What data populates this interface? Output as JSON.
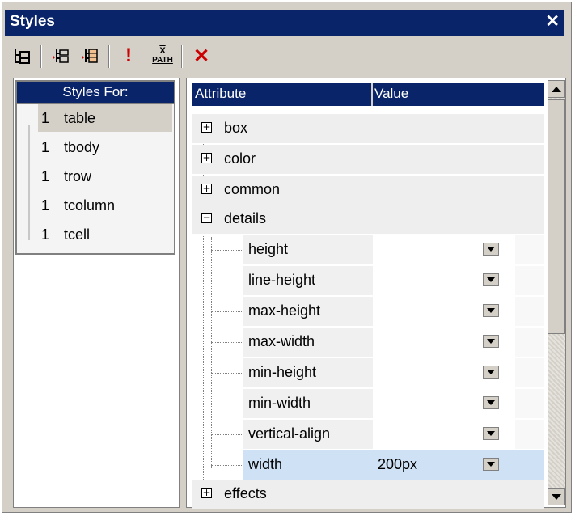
{
  "window": {
    "title": "Styles",
    "close_glyph": "✕"
  },
  "toolbar": {
    "buttons": [
      {
        "icon": "tree-structure-icon"
      },
      {
        "icon": "insert-style-icon"
      },
      {
        "icon": "append-style-icon"
      },
      {
        "icon": "important-icon",
        "label": "!"
      },
      {
        "icon": "xpath-icon",
        "label_top": "X",
        "label_bottom": "PATH"
      },
      {
        "icon": "delete-icon",
        "label": "✕"
      }
    ]
  },
  "styles_for": {
    "header": "Styles For:",
    "items": [
      {
        "count": "1",
        "name": "table",
        "selected": true
      },
      {
        "count": "1",
        "name": "tbody"
      },
      {
        "count": "1",
        "name": "trow"
      },
      {
        "count": "1",
        "name": "tcolumn"
      },
      {
        "count": "1",
        "name": "tcell"
      }
    ]
  },
  "grid": {
    "col_attribute": "Attribute",
    "col_value": "Value",
    "groups": [
      {
        "label": "box",
        "state": "+"
      },
      {
        "label": "color",
        "state": "+"
      },
      {
        "label": "common",
        "state": "+"
      },
      {
        "label": "details",
        "state": "−"
      },
      {
        "label": "effects",
        "state": "+"
      }
    ],
    "details_attributes": [
      {
        "name": "height",
        "value": ""
      },
      {
        "name": "line-height",
        "value": ""
      },
      {
        "name": "max-height",
        "value": ""
      },
      {
        "name": "max-width",
        "value": ""
      },
      {
        "name": "min-height",
        "value": ""
      },
      {
        "name": "min-width",
        "value": ""
      },
      {
        "name": "vertical-align",
        "value": ""
      },
      {
        "name": "width",
        "value": "200px",
        "selected": true
      }
    ]
  },
  "colors": {
    "header_bg": "#0a246a",
    "panel_bg": "#d4d0c8",
    "selected_row": "#cfe2f5",
    "delete_red": "#cc0000"
  }
}
